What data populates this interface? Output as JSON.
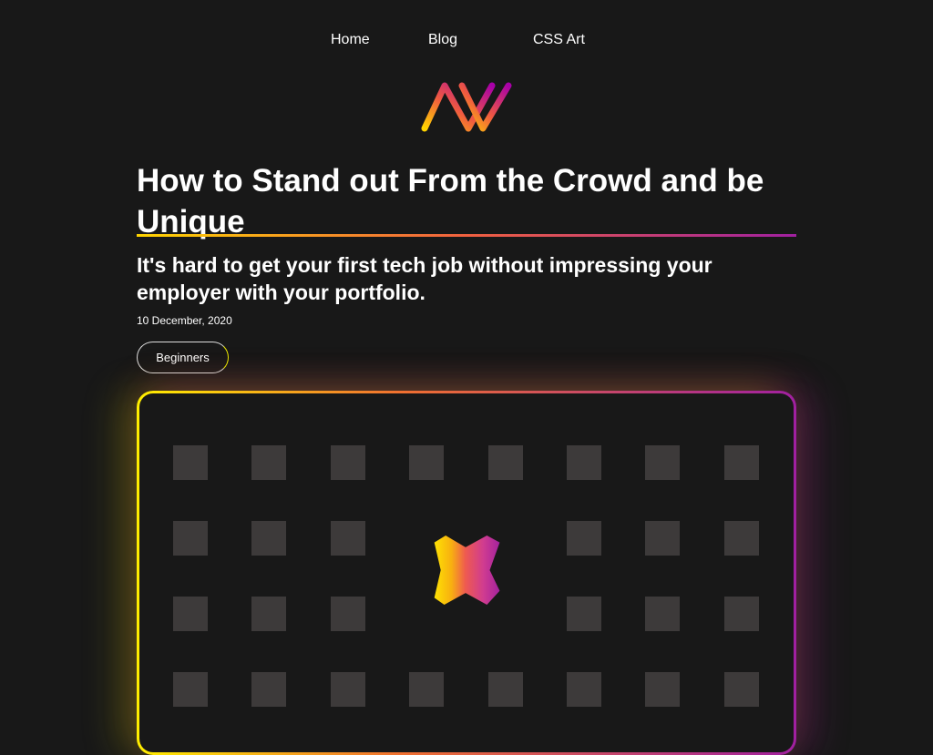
{
  "nav": {
    "items": [
      {
        "label": "Home"
      },
      {
        "label": "Blog"
      },
      {
        "label": "CSS Art"
      }
    ]
  },
  "article": {
    "title": "How to Stand out From the Crowd and be Unique",
    "subtitle": "It's hard to get your first tech job without impressing your employer with your portfolio.",
    "date": "10 December, 2020",
    "tag": "Beginners"
  },
  "colors": {
    "background": "#181818",
    "gradient_start": "#ffee00",
    "gradient_mid": "#f06040",
    "gradient_end": "#a020a0",
    "tile": "#3d3a3a"
  }
}
